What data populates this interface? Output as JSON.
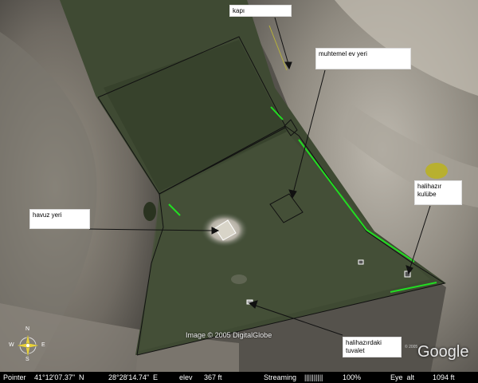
{
  "labels": {
    "kapi": "kapı",
    "muhtemel_ev": "muhtemel ev yeri",
    "havuz": "havuz yeri",
    "kulube": "halihazır kulübe",
    "tuvalet": "halihazırdaki tuvalet"
  },
  "credit": "Image © 2005 DigitalGlobe",
  "brand": "Google",
  "brand_small": "© 2005",
  "compass": {
    "n": "N",
    "s": "S",
    "w": "W",
    "e": "E"
  },
  "statusbar": {
    "pointer_label": "Pointer",
    "lat": "41°12'07.37\"  N",
    "lon": "28°28'14.74\"  E",
    "elev_label": "elev",
    "elev": "367 ft",
    "streaming_label": "Streaming",
    "streaming_bar": "||||||||||",
    "streaming_pct": "100%",
    "eye_label": "Eye  alt",
    "eye": "1094 ft"
  },
  "colors": {
    "boundary_line": "#111111",
    "fence_highlight": "#22dd22",
    "label_bg": "#ffffff"
  }
}
